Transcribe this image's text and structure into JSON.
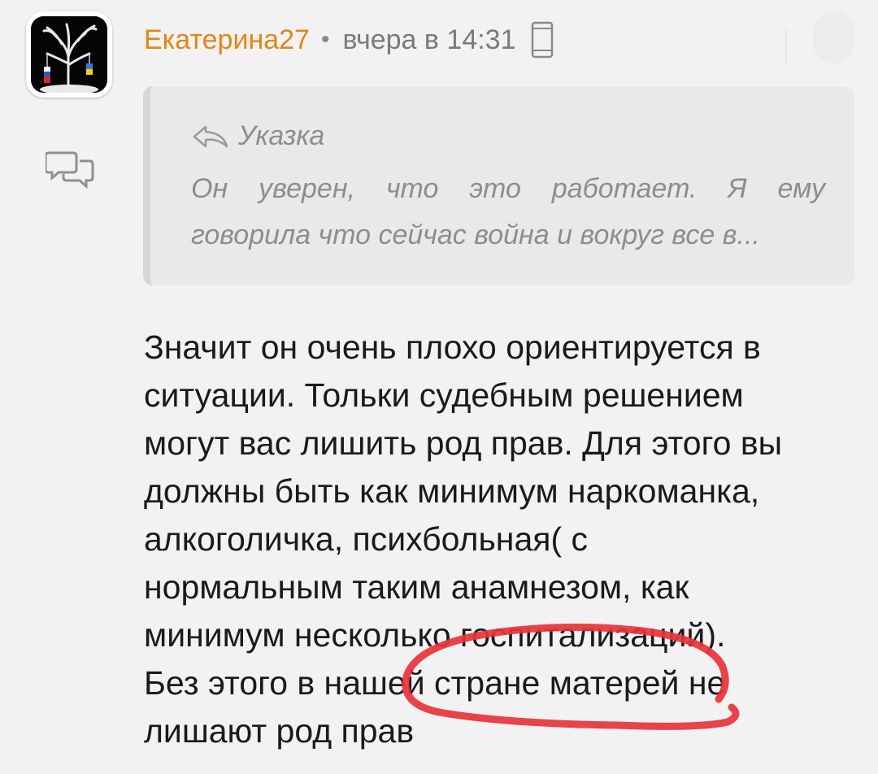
{
  "comment": {
    "author": "Екатерина27",
    "separator": "•",
    "time": "вчера в 14:31",
    "device_icon": "mobile-phone-icon",
    "avatar_icon": "tree-avatar-icon",
    "reply_icon": "chat-bubbles-icon",
    "quote": {
      "title": "Указка",
      "title_icon": "reply-arrow-icon",
      "lines": [
        "Он уверен, что это работает. Я ему",
        "говорила что сейчас война и вокруг все в..."
      ]
    },
    "text_lines": [
      "Значит он очень плохо ориентируется в",
      "ситуации. Тольки судебным решением",
      "могут вас лишить род прав. Для этого вы",
      "должны быть как минимум наркоманка,",
      "алкоголичка, психбольная( с",
      "нормальным таким анамнезом, как",
      "минимум несколько госпитализаций).",
      "Без этого в нашей стране матерей не",
      "лишают род прав"
    ],
    "annotation_icon": "red-hand-drawn-circle"
  },
  "colors": {
    "background": "#f2f2f2",
    "author": "#e08717",
    "meta": "#7a7a7a",
    "quote_bg": "#e9e9e9",
    "quote_text": "#8d8d8d",
    "body_text": "#1a1a1a",
    "annotation": "#e8333a"
  }
}
